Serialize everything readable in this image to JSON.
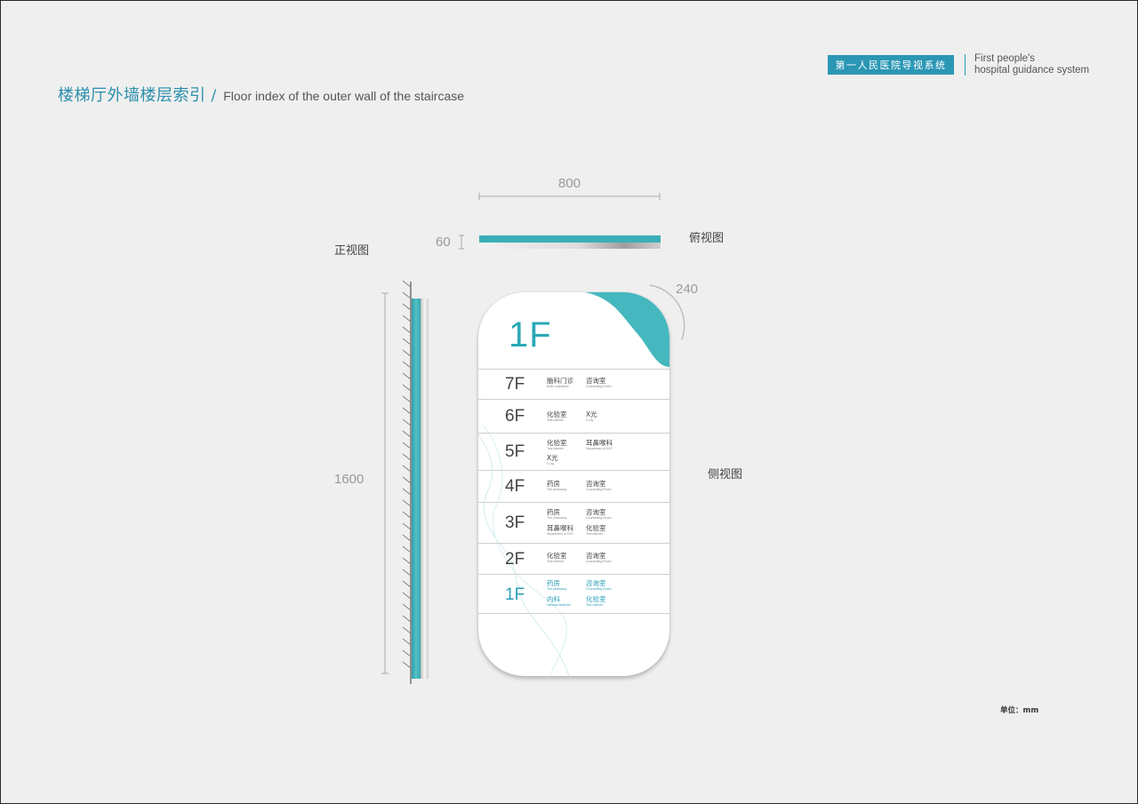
{
  "header": {
    "title_cn": "楼梯厅外墙楼层索引",
    "title_slash": "/",
    "title_en": "Floor index of the outer wall of the staircase",
    "brand_cn": "第一人民医院导视系统",
    "brand_en_line1": "First people's",
    "brand_en_line2": "hospital guidance system"
  },
  "views": {
    "front": "正视图",
    "top": "俯视图",
    "side": "侧视图"
  },
  "dimensions": {
    "width": "800",
    "depth": "60",
    "corner": "240",
    "height": "1600"
  },
  "unit_label": "单位：mm",
  "sign": {
    "current_floor": "1F",
    "floors": [
      {
        "label": "7F",
        "depts": [
          {
            "cn": "脑科门诊",
            "en": "Brain outpatient"
          },
          {
            "cn": "咨询室",
            "en": "Counselling Room"
          }
        ]
      },
      {
        "label": "6F",
        "depts": [
          {
            "cn": "化验室",
            "en": "Test cabinet"
          },
          {
            "cn": "X光",
            "en": "X-ray"
          }
        ]
      },
      {
        "label": "5F",
        "depts": [
          {
            "cn": "化验室",
            "en": "Test cabinet"
          },
          {
            "cn": "耳鼻喉科",
            "en": "Department of ENT"
          },
          {
            "cn": "X光",
            "en": "X-ray"
          }
        ]
      },
      {
        "label": "4F",
        "depts": [
          {
            "cn": "药房",
            "en": "The pharmacy"
          },
          {
            "cn": "咨询室",
            "en": "Counselling Room"
          }
        ]
      },
      {
        "label": "3F",
        "depts": [
          {
            "cn": "药房",
            "en": "The pharmacy"
          },
          {
            "cn": "咨询室",
            "en": "Counselling Room"
          },
          {
            "cn": "耳鼻喉科",
            "en": "Department of ENT"
          },
          {
            "cn": "化验室",
            "en": "Test cabinet"
          }
        ]
      },
      {
        "label": "2F",
        "depts": [
          {
            "cn": "化验室",
            "en": "Test cabinet"
          },
          {
            "cn": "咨询室",
            "en": "Counselling Room"
          }
        ]
      },
      {
        "label": "1F",
        "depts": [
          {
            "cn": "药房",
            "en": "The pharmacy"
          },
          {
            "cn": "咨询室",
            "en": "Counselling Room"
          },
          {
            "cn": "内科",
            "en": "Internal medicine"
          },
          {
            "cn": "化验室",
            "en": "Test cabinet"
          }
        ]
      }
    ]
  },
  "colors": {
    "accent": "#2b97b4",
    "teal": "#45b8bf",
    "background": "#efefef"
  }
}
